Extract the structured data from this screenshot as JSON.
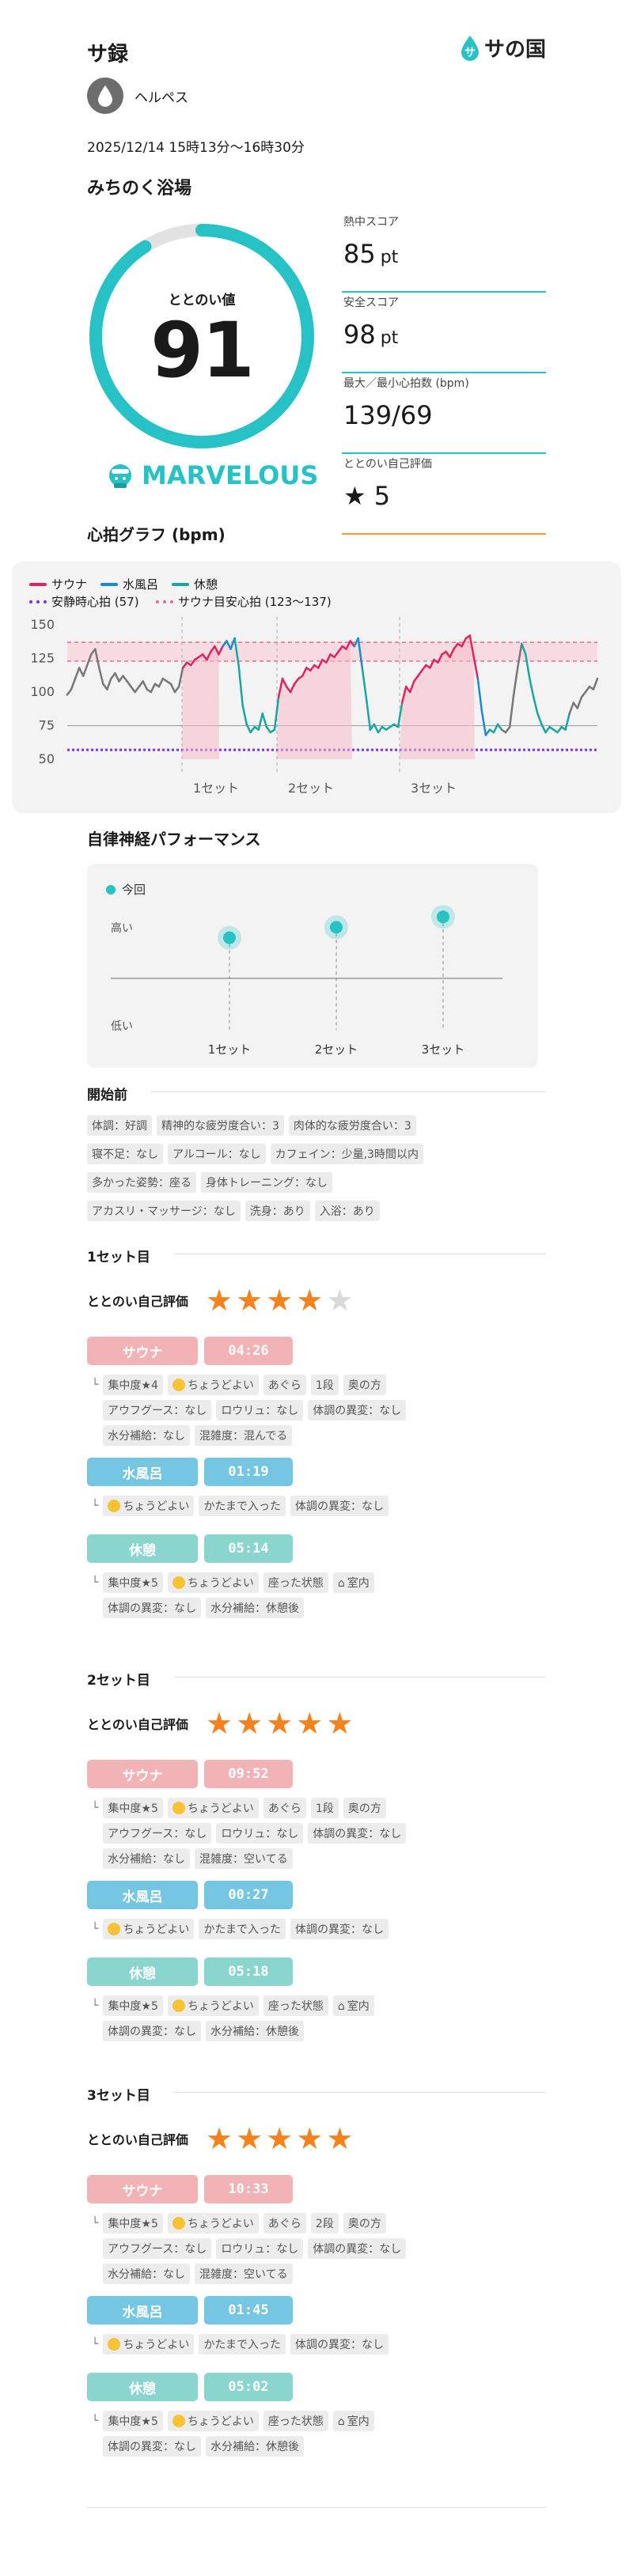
{
  "header": {
    "title": "サ録",
    "logo_text": "サの国"
  },
  "user": {
    "name": "ヘルペス"
  },
  "session": {
    "datetime": "2025/12/14 15時13分〜16時30分",
    "place": "みちのく浴場"
  },
  "totonoi": {
    "label": "ととのい値",
    "value": "91",
    "progress": 0.91,
    "grade": "MARVELOUS"
  },
  "scores": [
    {
      "label": "熱中スコア",
      "value": "85",
      "unit": "pt"
    },
    {
      "label": "安全スコア",
      "value": "98",
      "unit": "pt"
    },
    {
      "label": "最大／最小心拍数 (bpm)",
      "value": "139/69",
      "unit": ""
    },
    {
      "label": "ととのい自己評価",
      "value": "5",
      "unit": ""
    }
  ],
  "colors": {
    "accent": "#26c2c5",
    "sauna": "#e0245e",
    "water": "#1a8ad1",
    "rest": "#17a7a0",
    "resting": "#7b2ff2",
    "target": "#f06a8b",
    "orange": "#f4821f"
  },
  "heart": {
    "title": "心拍グラフ (bpm)",
    "legend": {
      "sauna": "サウナ",
      "water": "水風呂",
      "rest": "休憩",
      "resting": "安静時心拍 (57)",
      "target": "サウナ目安心拍 (123〜137)"
    },
    "chart_data": {
      "type": "line",
      "ylim": [
        50,
        150
      ],
      "yticks": [
        "150",
        "125",
        "100",
        "75",
        "50"
      ],
      "resting": 57,
      "target_band": [
        123,
        137
      ],
      "set_labels": [
        "1セット",
        "2セット",
        "3セット"
      ],
      "points": [
        98,
        102,
        110,
        118,
        112,
        120,
        128,
        132,
        118,
        106,
        102,
        110,
        114,
        108,
        112,
        108,
        104,
        100,
        104,
        108,
        102,
        100,
        106,
        104,
        110,
        108,
        106,
        100,
        104,
        118,
        122,
        120,
        124,
        126,
        128,
        124,
        130,
        134,
        128,
        134,
        138,
        132,
        140,
        120,
        90,
        76,
        70,
        74,
        72,
        84,
        74,
        70,
        72,
        96,
        110,
        104,
        100,
        106,
        110,
        112,
        118,
        116,
        120,
        118,
        124,
        122,
        128,
        126,
        130,
        134,
        132,
        138,
        134,
        140,
        118,
        96,
        72,
        76,
        70,
        74,
        72,
        74,
        76,
        74,
        92,
        104,
        100,
        108,
        112,
        116,
        120,
        118,
        124,
        122,
        128,
        130,
        126,
        132,
        136,
        134,
        140,
        142,
        126,
        110,
        86,
        68,
        72,
        70,
        76,
        72,
        70,
        74,
        98,
        118,
        136,
        128,
        110,
        96,
        84,
        76,
        70,
        74,
        72,
        70,
        74,
        72,
        84,
        92,
        88,
        96,
        100,
        104,
        102,
        110
      ]
    },
    "sets": [
      {
        "label": "1セット"
      },
      {
        "label": "2セット"
      },
      {
        "label": "3セット"
      }
    ]
  },
  "ans": {
    "title": "自律神経パフォーマンス",
    "legend": "今回",
    "high": "高い",
    "low": "低い",
    "chart_data": {
      "type": "scatter",
      "categories": [
        "1セット",
        "2セット",
        "3セット"
      ],
      "values": [
        0.62,
        0.68,
        0.74
      ]
    }
  },
  "pre": {
    "title": "開始前",
    "tags": [
      [
        "体調：好調",
        "精神的な疲労度合い：3",
        "肉体的な疲労度合い：3"
      ],
      [
        "寝不足：なし",
        "アルコール：なし",
        "カフェイン：少量,3時間以内"
      ],
      [
        "多かった姿勢：座る",
        "身体トレーニング：なし"
      ],
      [
        "アカスリ・マッサージ：なし",
        "洗身：あり",
        "入浴：あり"
      ]
    ]
  },
  "sets": [
    {
      "title": "1セット目",
      "rating_label": "ととのい自己評価",
      "rating": 4,
      "sauna": {
        "label": "サウナ",
        "time": "04:26",
        "tags": [
          [
            "集中度★4",
            "ちょうどよい",
            "あぐら",
            "1段",
            "奥の方"
          ],
          [
            "アウフグース：なし",
            "ロウリュ：なし",
            "体調の異変：なし"
          ],
          [
            "水分補給：なし",
            "混雑度：混んでる"
          ]
        ]
      },
      "water": {
        "label": "水風呂",
        "time": "01:19",
        "tags": [
          [
            "ちょうどよい",
            "かたまで入った",
            "体調の異変：なし"
          ]
        ]
      },
      "rest": {
        "label": "休憩",
        "time": "05:14",
        "tags": [
          [
            "集中度★5",
            "ちょうどよい",
            "座った状態",
            "室内"
          ],
          [
            "体調の異変：なし",
            "水分補給：休憩後"
          ]
        ]
      }
    },
    {
      "title": "2セット目",
      "rating_label": "ととのい自己評価",
      "rating": 5,
      "sauna": {
        "label": "サウナ",
        "time": "09:52",
        "tags": [
          [
            "集中度★5",
            "ちょうどよい",
            "あぐら",
            "1段",
            "奥の方"
          ],
          [
            "アウフグース：なし",
            "ロウリュ：なし",
            "体調の異変：なし"
          ],
          [
            "水分補給：なし",
            "混雑度：空いてる"
          ]
        ]
      },
      "water": {
        "label": "水風呂",
        "time": "00:27",
        "tags": [
          [
            "ちょうどよい",
            "かたまで入った",
            "体調の異変：なし"
          ]
        ]
      },
      "rest": {
        "label": "休憩",
        "time": "05:18",
        "tags": [
          [
            "集中度★5",
            "ちょうどよい",
            "座った状態",
            "室内"
          ],
          [
            "体調の異変：なし",
            "水分補給：休憩後"
          ]
        ]
      }
    },
    {
      "title": "3セット目",
      "rating_label": "ととのい自己評価",
      "rating": 5,
      "sauna": {
        "label": "サウナ",
        "time": "10:33",
        "tags": [
          [
            "集中度★5",
            "ちょうどよい",
            "あぐら",
            "2段",
            "奥の方"
          ],
          [
            "アウフグース：なし",
            "ロウリュ：なし",
            "体調の異変：なし"
          ],
          [
            "水分補給：なし",
            "混雑度：空いてる"
          ]
        ]
      },
      "water": {
        "label": "水風呂",
        "time": "01:45",
        "tags": [
          [
            "ちょうどよい",
            "かたまで入った",
            "体調の異変：なし"
          ]
        ]
      },
      "rest": {
        "label": "休憩",
        "time": "05:02",
        "tags": [
          [
            "集中度★5",
            "ちょうどよい",
            "座った状態",
            "室内"
          ],
          [
            "体調の異変：なし",
            "水分補給：休憩後"
          ]
        ]
      }
    }
  ]
}
